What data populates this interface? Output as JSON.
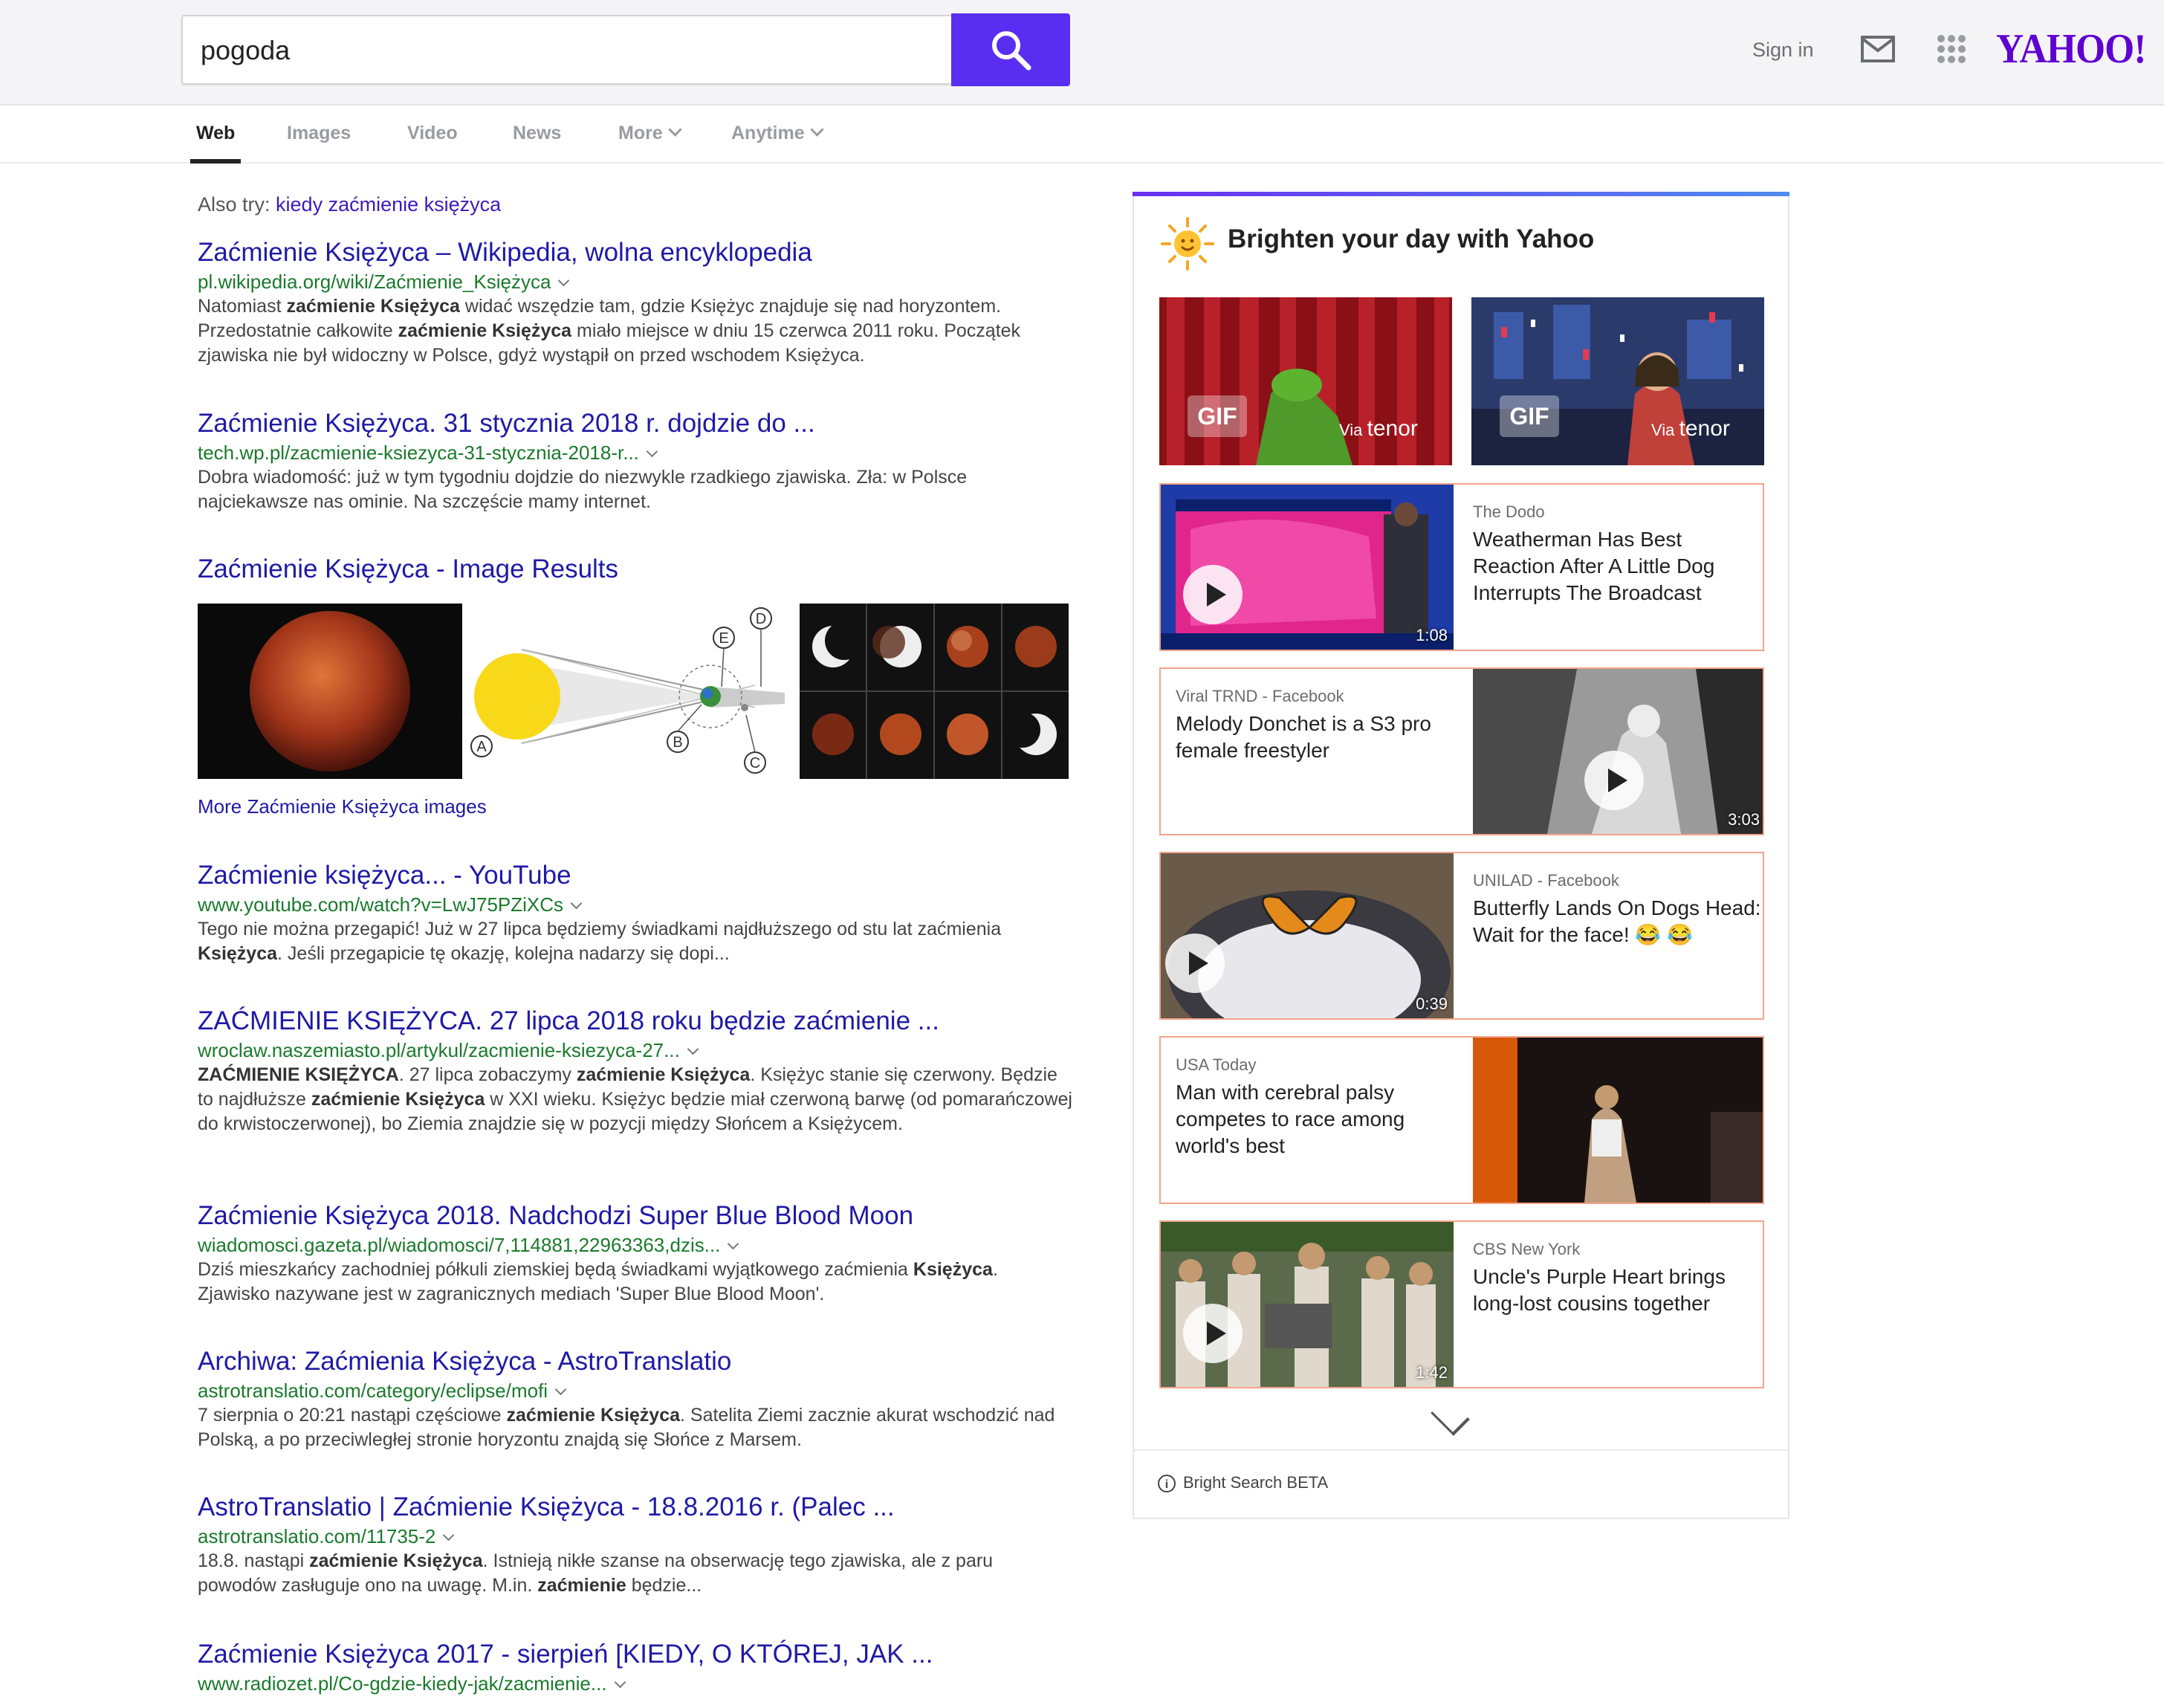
{
  "search": {
    "query": "pogoda"
  },
  "header": {
    "signin_label": "Sign in",
    "logo": "YAHOO!",
    "icons": [
      "search-icon",
      "mail-icon",
      "apps-grid-icon"
    ]
  },
  "tabs": [
    {
      "label": "Web"
    },
    {
      "label": "Images"
    },
    {
      "label": "Video"
    },
    {
      "label": "News"
    },
    {
      "label": "More"
    },
    {
      "label": "Anytime"
    }
  ],
  "also_try": {
    "label": "Also try:",
    "link": "kiedy zaćmienie księżyca"
  },
  "results": [
    {
      "title": "Zaćmienie Księżyca – Wikipedia, wolna encyklopedia",
      "url": "pl.wikipedia.org/wiki/Zaćmienie_Księżyca",
      "snippet_html": "Natomiast <b>zaćmienie Księżyca</b> widać wszędzie tam, gdzie Księżyc znajduje się nad horyzontem. Przedostatnie całkowite <b>zaćmienie Księżyca</b> miało miejsce w dniu 15 czerwca 2011 roku. Początek zjawiska nie był widoczny w Polsce, gdyż wystąpił on przed wschodem Księżyca."
    },
    {
      "title": "Zaćmienie Księżyca. 31 stycznia 2018 r. dojdzie do ...",
      "url": "tech.wp.pl/zacmienie-ksiezyca-31-stycznia-2018-r...",
      "snippet_html": "Dobra wiadomość: już w tym tygodniu dojdzie do niezwykle rzadkiego zjawiska. Zła: w Polsce najciekawsze nas ominie. Na szczęście mamy internet."
    },
    {
      "title": "Zaćmienie księżyca... - YouTube",
      "url": "www.youtube.com/watch?v=LwJ75PZiXCs",
      "snippet_html": "Tego nie można przegapić! Już w 27 lipca będziemy świadkami najdłuższego od stu lat zaćmienia <b>Księżyca</b>. Jeśli przegapicie tę okazję, kolejna nadarzy się dopi..."
    },
    {
      "title": "ZAĆMIENIE KSIĘŻYCA. 27 lipca 2018 roku będzie zaćmienie ...",
      "url": "wroclaw.naszemiasto.pl/artykul/zacmienie-ksiezyca-27...",
      "snippet_html": "<b>ZAĆMIENIE KSIĘŻYCA</b>. 27 lipca zobaczymy <b>zaćmienie Księżyca</b>. Księżyc stanie się czerwony. Będzie to najdłuższe <b>zaćmienie Księżyca</b> w XXI wieku. Księżyc będzie miał czerwoną barwę (od pomarańczowej do krwistoczerwonej), bo Ziemia znajdzie się w pozycji między Słońcem a Księżycem."
    },
    {
      "title": "Zaćmienie Księżyca 2018. Nadchodzi Super Blue Blood Moon",
      "url": "wiadomosci.gazeta.pl/wiadomosci/7,114881,22963363,dzis...",
      "snippet_html": "Dziś mieszkańcy zachodniej półkuli ziemskiej będą świadkami wyjątkowego zaćmienia <b>Księżyca</b>. Zjawisko nazywane jest w zagranicznych mediach 'Super Blue Blood Moon'."
    },
    {
      "title": "Archiwa: Zaćmienia Księżyca - AstroTranslatio",
      "url": "astrotranslatio.com/category/eclipse/mofi",
      "snippet_html": "7 sierpnia o 20:21 nastąpi częściowe <b>zaćmienie Księżyca</b>. Satelita Ziemi zacznie akurat wschodzić nad Polską, a po przeciwległej stronie horyzontu znajdą się Słońce z Marsem."
    },
    {
      "title": "AstroTranslatio | Zaćmienie Księżyca - 18.8.2016 r. (Palec ...",
      "url": "astrotranslatio.com/11735-2",
      "snippet_html": "18.8. nastąpi <b>zaćmienie Księżyca</b>. Istnieją nikłe szanse na obserwację tego zjawiska, ale z paru powodów zasługuje ono na uwagę. M.in. <b>zaćmienie</b> będzie..."
    },
    {
      "title": "Zaćmienie Księżyca 2017 - sierpień [KIEDY, O KTÓREJ, JAK ...",
      "url": "www.radiozet.pl/Co-gdzie-kiedy-jak/zacmienie...",
      "snippet_html": ""
    }
  ],
  "image_results": {
    "title": "Zaćmienie Księżyca - Image Results",
    "more_label": "More Zaćmienie Księżyca images",
    "diagram_labels": [
      "A",
      "B",
      "C",
      "D",
      "E"
    ]
  },
  "panel": {
    "title": "Brighten your day with Yahoo",
    "gifs": [
      {
        "badge": "GIF",
        "via": "Via",
        "brand": "tenor"
      },
      {
        "badge": "GIF",
        "via": "Via",
        "brand": "tenor"
      }
    ],
    "cards": [
      {
        "source": "The Dodo",
        "headline": "Weatherman Has Best Reaction After A Little Dog Interrupts The Broadcast",
        "duration": "1:08",
        "thumb_side": "left"
      },
      {
        "source": "Viral TRND - Facebook",
        "headline": "Melody Donchet is a S3 pro female freestyler",
        "duration": "3:03",
        "thumb_side": "right"
      },
      {
        "source": "UNILAD - Facebook",
        "headline": "Butterfly Lands On Dogs Head: Wait for the face! 😂 😂",
        "duration": "0:39",
        "thumb_side": "left"
      },
      {
        "source": "USA Today",
        "headline": "Man with cerebral palsy competes to race among world's best",
        "duration": "",
        "thumb_side": "right"
      },
      {
        "source": "CBS New York",
        "headline": "Uncle's Purple Heart brings long-lost cousins together",
        "duration": "1:42",
        "thumb_side": "left"
      }
    ],
    "footer_label": "Bright Search BETA"
  },
  "colors": {
    "accent": "#5a2ef0",
    "logo": "#5f01d1",
    "link": "#1f1aa6",
    "url": "#1a7a2c",
    "card_border": "#f4a48c"
  }
}
